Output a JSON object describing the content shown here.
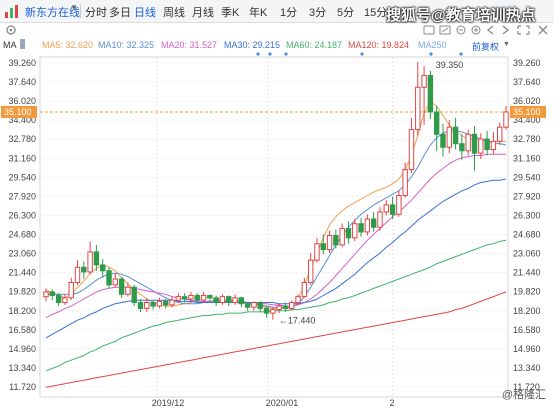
{
  "toolbar": {
    "logo_icon": "app-logo-icon",
    "source_label": "新东方在线",
    "periods": [
      "分时",
      "多日",
      "日线",
      "周线",
      "月线",
      "季K",
      "年K",
      "1分",
      "3分",
      "5分",
      "15分"
    ],
    "active_period": "日线",
    "watermark": "搜狐号@教育培训热点"
  },
  "ma_bar": {
    "label": "MA",
    "items": [
      {
        "name": "MA5",
        "value": "32.620",
        "color": "#f2a04b"
      },
      {
        "name": "MA10",
        "value": "32.325",
        "color": "#5b8fd6"
      },
      {
        "name": "MA20",
        "value": "31.527",
        "color": "#d35fc8"
      },
      {
        "name": "MA30",
        "value": "29.215",
        "color": "#3a6fd8"
      },
      {
        "name": "MA60",
        "value": "24.187",
        "color": "#41b36a"
      },
      {
        "name": "MA120",
        "value": "19.824",
        "color": "#e04646"
      },
      {
        "name": "MA250",
        "value": "",
        "color": "#7fa8e8"
      }
    ],
    "right_label": "前复权"
  },
  "chart_data": {
    "type": "candlestick",
    "y_ticks": [
      "39.260",
      "37.640",
      "36.020",
      "34.400",
      "32.780",
      "31.160",
      "29.540",
      "27.920",
      "26.300",
      "24.680",
      "23.060",
      "21.440",
      "19.820",
      "18.200",
      "16.580",
      "14.960",
      "13.340",
      "11.720"
    ],
    "ylim": [
      11.72,
      39.26
    ],
    "x_labels": [
      "2019/12",
      "2020/01",
      "2"
    ],
    "current_price": "35.100",
    "annotations": {
      "high": "39.350",
      "low": "17.440"
    },
    "ma_lines": {
      "MA5": [
        19.9,
        19.8,
        19.5,
        19.3,
        19.6,
        20.2,
        20.7,
        21.4,
        21.8,
        22.1,
        21.9,
        21.6,
        21.0,
        20.5,
        20.0,
        19.6,
        19.2,
        18.9,
        18.7,
        18.6,
        18.6,
        18.7,
        18.8,
        18.9,
        19.1,
        19.3,
        19.3,
        19.2,
        19.1,
        19.1,
        19.0,
        18.9,
        18.8,
        18.7,
        18.6,
        18.5,
        18.4,
        18.4,
        18.4,
        18.6,
        19.2,
        20.4,
        21.8,
        23.1,
        24.4,
        25.5,
        26.2,
        26.7,
        27.1,
        27.4,
        27.7,
        28.0,
        28.3,
        28.5,
        28.7,
        29.0,
        29.4,
        30.2,
        31.4,
        33.1,
        35.0,
        36.0,
        35.6,
        34.8,
        34.0,
        33.4,
        33.1,
        32.8,
        32.8,
        32.7,
        32.6,
        32.6,
        32.6,
        32.6
      ],
      "MA10": [
        19.6,
        19.6,
        19.6,
        19.6,
        19.6,
        19.7,
        20.0,
        20.4,
        20.8,
        21.1,
        21.3,
        21.4,
        21.3,
        21.1,
        20.8,
        20.5,
        20.2,
        19.9,
        19.6,
        19.3,
        19.1,
        18.9,
        18.8,
        18.8,
        18.8,
        18.9,
        19.0,
        19.1,
        19.1,
        19.1,
        19.1,
        19.0,
        18.9,
        18.8,
        18.7,
        18.6,
        18.5,
        18.5,
        18.4,
        18.5,
        18.8,
        19.4,
        20.2,
        21.1,
        22.0,
        22.9,
        23.8,
        24.6,
        25.3,
        25.9,
        26.4,
        26.8,
        27.2,
        27.5,
        27.8,
        28.1,
        28.4,
        28.9,
        29.6,
        30.4,
        31.4,
        32.3,
        32.9,
        33.3,
        33.5,
        33.5,
        33.4,
        33.2,
        33.0,
        32.8,
        32.6,
        32.5,
        32.4,
        32.3
      ],
      "MA20": [
        17.6,
        17.9,
        18.1,
        18.4,
        18.6,
        18.9,
        19.2,
        19.5,
        19.8,
        20.0,
        20.1,
        20.2,
        20.2,
        20.2,
        20.1,
        20.0,
        19.9,
        19.8,
        19.7,
        19.6,
        19.4,
        19.3,
        19.2,
        19.1,
        19.0,
        19.0,
        19.0,
        19.0,
        19.0,
        19.0,
        18.9,
        18.9,
        18.9,
        18.9,
        18.8,
        18.8,
        18.7,
        18.7,
        18.6,
        18.6,
        18.7,
        18.9,
        19.2,
        19.6,
        20.1,
        20.6,
        21.2,
        21.8,
        22.4,
        23.0,
        23.6,
        24.2,
        24.7,
        25.2,
        25.7,
        26.2,
        26.6,
        27.1,
        27.6,
        28.2,
        28.8,
        29.4,
        29.9,
        30.3,
        30.7,
        31.0,
        31.2,
        31.3,
        31.4,
        31.4,
        31.5,
        31.5,
        31.5,
        31.5
      ],
      "MA30": [
        15.9,
        16.2,
        16.5,
        16.8,
        17.1,
        17.4,
        17.6,
        17.9,
        18.1,
        18.4,
        18.6,
        18.8,
        18.9,
        19.0,
        19.1,
        19.1,
        19.1,
        19.1,
        19.1,
        19.1,
        19.1,
        19.0,
        19.0,
        19.0,
        18.9,
        18.9,
        18.9,
        18.9,
        18.9,
        18.9,
        18.9,
        18.9,
        18.9,
        18.9,
        18.9,
        18.9,
        18.9,
        18.8,
        18.8,
        18.8,
        18.8,
        18.9,
        19.0,
        19.2,
        19.5,
        19.8,
        20.1,
        20.5,
        20.9,
        21.3,
        21.8,
        22.3,
        22.7,
        23.1,
        23.6,
        24.0,
        24.5,
        24.9,
        25.4,
        25.9,
        26.3,
        26.7,
        27.1,
        27.5,
        27.8,
        28.1,
        28.4,
        28.6,
        28.9,
        29.1,
        29.2,
        29.3,
        29.3,
        29.4
      ],
      "MA60": [
        13.1,
        13.3,
        13.5,
        13.8,
        14.0,
        14.2,
        14.4,
        14.7,
        14.9,
        15.2,
        15.4,
        15.6,
        15.9,
        16.1,
        16.3,
        16.5,
        16.7,
        16.9,
        17.0,
        17.2,
        17.3,
        17.4,
        17.5,
        17.6,
        17.7,
        17.8,
        17.8,
        17.9,
        17.9,
        18.0,
        18.0,
        18.0,
        18.1,
        18.1,
        18.1,
        18.1,
        18.2,
        18.2,
        18.2,
        18.3,
        18.3,
        18.4,
        18.5,
        18.6,
        18.7,
        18.9,
        19.0,
        19.2,
        19.3,
        19.5,
        19.7,
        19.9,
        20.1,
        20.3,
        20.5,
        20.7,
        20.9,
        21.1,
        21.3,
        21.5,
        21.7,
        21.9,
        22.2,
        22.4,
        22.6,
        22.8,
        23.0,
        23.2,
        23.4,
        23.6,
        23.8,
        23.9,
        24.1,
        24.2
      ],
      "MA120": [
        11.7,
        11.8,
        11.9,
        12.0,
        12.1,
        12.2,
        12.3,
        12.4,
        12.5,
        12.6,
        12.7,
        12.8,
        12.9,
        13.0,
        13.1,
        13.2,
        13.3,
        13.4,
        13.5,
        13.6,
        13.7,
        13.8,
        13.9,
        14.0,
        14.1,
        14.2,
        14.3,
        14.4,
        14.5,
        14.6,
        14.7,
        14.8,
        14.9,
        15.0,
        15.1,
        15.2,
        15.3,
        15.4,
        15.5,
        15.6,
        15.7,
        15.8,
        15.9,
        16.0,
        16.1,
        16.2,
        16.3,
        16.4,
        16.5,
        16.6,
        16.7,
        16.8,
        16.9,
        17.0,
        17.1,
        17.2,
        17.3,
        17.4,
        17.5,
        17.6,
        17.7,
        17.8,
        17.9,
        18.0,
        18.1,
        18.3,
        18.4,
        18.6,
        18.8,
        19.0,
        19.2,
        19.4,
        19.6,
        19.8
      ]
    },
    "candles": [
      [
        19.4,
        19.8,
        20.1,
        19.0
      ],
      [
        19.8,
        19.5,
        20.0,
        19.1
      ],
      [
        19.5,
        18.9,
        19.7,
        18.6
      ],
      [
        18.9,
        19.3,
        19.6,
        18.7
      ],
      [
        19.3,
        20.6,
        21.0,
        19.1
      ],
      [
        20.6,
        21.9,
        22.5,
        20.4
      ],
      [
        21.9,
        21.5,
        22.4,
        20.9
      ],
      [
        21.5,
        23.2,
        24.1,
        21.3
      ],
      [
        23.2,
        22.1,
        23.8,
        21.6
      ],
      [
        22.1,
        21.6,
        22.6,
        21.0
      ],
      [
        21.6,
        20.4,
        21.9,
        20.1
      ],
      [
        20.4,
        20.9,
        21.4,
        20.2
      ],
      [
        20.9,
        19.6,
        21.1,
        19.3
      ],
      [
        19.6,
        20.2,
        20.6,
        19.4
      ],
      [
        20.2,
        18.9,
        20.4,
        18.6
      ],
      [
        18.9,
        18.4,
        19.2,
        18.1
      ],
      [
        18.4,
        18.9,
        19.3,
        18.1
      ],
      [
        18.9,
        18.6,
        19.1,
        18.3
      ],
      [
        18.6,
        19.0,
        19.3,
        18.4
      ],
      [
        19.0,
        18.7,
        19.2,
        18.4
      ],
      [
        18.7,
        19.1,
        19.4,
        18.5
      ],
      [
        19.1,
        19.4,
        19.7,
        18.9
      ],
      [
        19.4,
        19.2,
        19.7,
        18.9
      ],
      [
        19.2,
        19.5,
        19.8,
        19.0
      ],
      [
        19.5,
        19.1,
        19.7,
        18.9
      ],
      [
        19.1,
        19.5,
        19.8,
        18.9
      ],
      [
        19.5,
        19.3,
        19.6,
        18.9
      ],
      [
        19.3,
        18.9,
        19.5,
        18.6
      ],
      [
        18.9,
        19.4,
        19.6,
        18.7
      ],
      [
        19.4,
        18.9,
        19.5,
        18.6
      ],
      [
        18.9,
        19.3,
        19.6,
        18.7
      ],
      [
        19.3,
        18.8,
        19.4,
        18.5
      ],
      [
        18.8,
        18.5,
        18.9,
        18.2
      ],
      [
        18.5,
        18.9,
        19.0,
        18.2
      ],
      [
        18.9,
        18.4,
        19.0,
        18.1
      ],
      [
        18.4,
        18.0,
        18.6,
        17.6
      ],
      [
        18.0,
        18.3,
        18.5,
        17.44
      ],
      [
        18.3,
        18.6,
        18.8,
        18.0
      ],
      [
        18.6,
        18.4,
        18.9,
        18.1
      ],
      [
        18.4,
        18.9,
        19.1,
        18.2
      ],
      [
        18.9,
        19.4,
        19.6,
        18.7
      ],
      [
        19.4,
        20.6,
        21.0,
        19.3
      ],
      [
        20.6,
        22.5,
        23.1,
        20.4
      ],
      [
        22.5,
        23.9,
        24.4,
        22.3
      ],
      [
        23.9,
        23.4,
        24.7,
        23.0
      ],
      [
        23.4,
        24.6,
        25.0,
        23.1
      ],
      [
        24.6,
        23.8,
        25.1,
        23.5
      ],
      [
        23.8,
        25.2,
        25.6,
        23.6
      ],
      [
        25.2,
        24.4,
        25.8,
        23.9
      ],
      [
        24.4,
        25.6,
        26.0,
        24.1
      ],
      [
        25.6,
        24.9,
        26.1,
        24.5
      ],
      [
        24.9,
        26.0,
        26.4,
        24.6
      ],
      [
        26.0,
        25.3,
        26.6,
        24.9
      ],
      [
        25.3,
        26.6,
        27.0,
        25.0
      ],
      [
        26.6,
        27.2,
        27.6,
        26.3
      ],
      [
        27.2,
        26.4,
        27.9,
        26.0
      ],
      [
        26.4,
        28.0,
        28.4,
        26.2
      ],
      [
        28.0,
        30.2,
        30.8,
        27.8
      ],
      [
        30.2,
        33.6,
        34.6,
        29.9
      ],
      [
        33.6,
        37.2,
        39.35,
        33.1
      ],
      [
        37.2,
        38.2,
        39.0,
        34.0
      ],
      [
        38.2,
        35.1,
        38.6,
        34.5
      ],
      [
        35.1,
        33.2,
        35.6,
        31.8
      ],
      [
        33.2,
        32.1,
        34.1,
        31.3
      ],
      [
        32.1,
        33.8,
        34.4,
        31.6
      ],
      [
        33.8,
        32.4,
        34.6,
        31.9
      ],
      [
        32.4,
        31.8,
        33.2,
        31.0
      ],
      [
        31.8,
        33.2,
        33.6,
        31.4
      ],
      [
        33.2,
        31.6,
        33.9,
        30.1
      ],
      [
        31.6,
        32.8,
        33.3,
        31.1
      ],
      [
        32.8,
        31.9,
        33.5,
        31.4
      ],
      [
        31.9,
        32.6,
        33.4,
        31.5
      ],
      [
        32.6,
        33.8,
        34.2,
        32.3
      ],
      [
        33.8,
        35.1,
        35.6,
        33.6
      ]
    ]
  },
  "footer": {
    "brand": "@格隆汇"
  }
}
